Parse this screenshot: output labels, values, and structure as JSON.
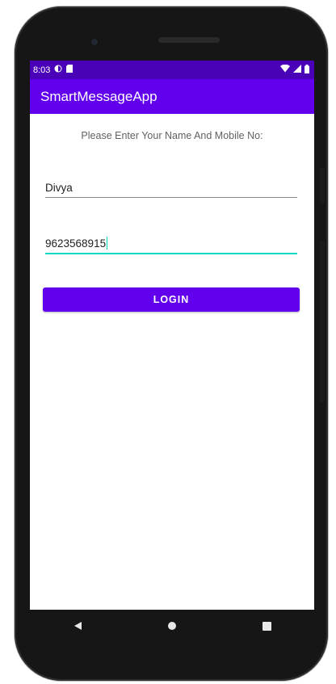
{
  "status_bar": {
    "time": "8:03",
    "left_icons": [
      "sync-icon",
      "sim-card-icon"
    ],
    "right_icons": [
      "wifi-icon",
      "signal-icon",
      "battery-icon"
    ]
  },
  "app_bar": {
    "title": "SmartMessageApp"
  },
  "form": {
    "prompt": "Please Enter Your Name And Mobile No:",
    "name_value": "Divya",
    "mobile_value": "9623568915",
    "login_label": "LOGIN"
  },
  "navigation": {
    "keys": [
      "back-icon",
      "home-icon",
      "recents-icon"
    ]
  },
  "colors": {
    "primary": "#6200ee",
    "primary_dark": "#4a02b8",
    "accent": "#03dac5",
    "phone_frame": "#161616"
  }
}
